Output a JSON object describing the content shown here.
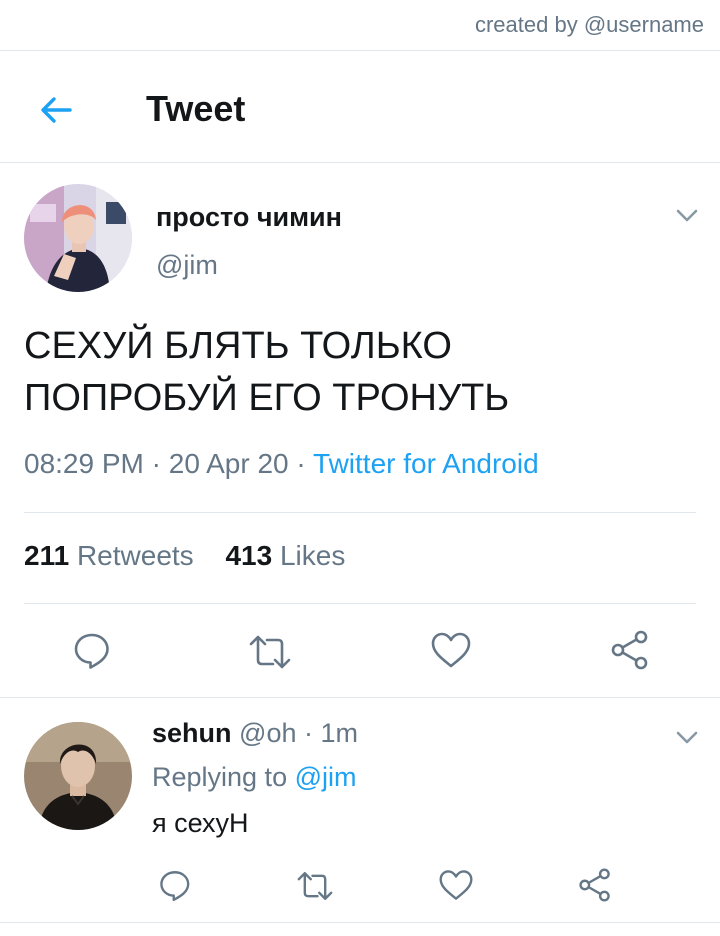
{
  "watermark": "created by @username",
  "header": {
    "title": "Tweet"
  },
  "tweet": {
    "author_name": "просто чимин",
    "author_handle": "@jim",
    "text": "СЕХУЙ БЛЯТЬ ТОЛЬКО\nПОПРОБУЙ  ЕГО ТРОНУТЬ",
    "time": "08:29 PM",
    "date": "20 Apr 20",
    "source": "Twitter for Android",
    "retweets_count": "211",
    "retweets_label": "Retweets",
    "likes_count": "413",
    "likes_label": "Likes"
  },
  "reply": {
    "author_name": "sehun",
    "author_handle": "@oh",
    "time_ago": "1m",
    "replying_prefix": "Replying to",
    "replying_to": "@jim",
    "text": "я сехуН"
  },
  "icons": [
    "back-arrow-icon",
    "chevron-down-icon",
    "reply-icon",
    "retweet-icon",
    "like-icon",
    "share-icon"
  ],
  "colors": {
    "accent": "#1da1f2",
    "secondary_text": "#657786",
    "divider": "#e1e8ed",
    "primary_text": "#14171a"
  }
}
